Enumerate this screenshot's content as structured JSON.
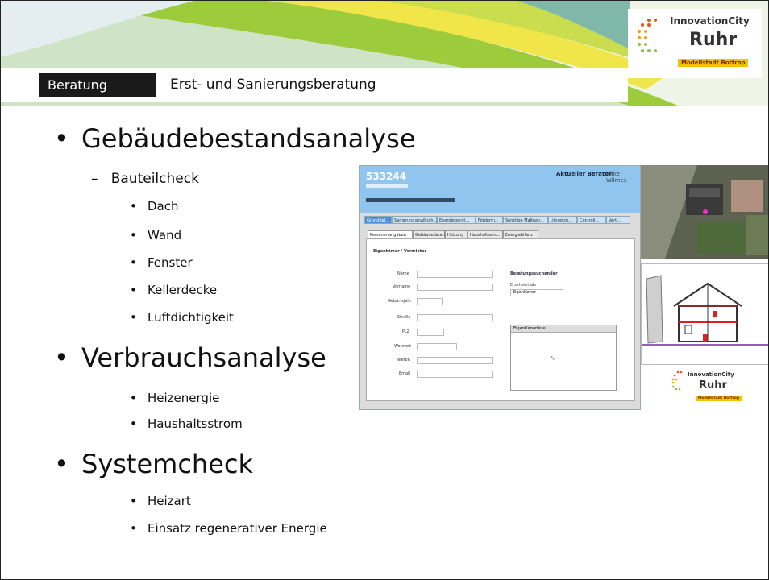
{
  "header": {
    "tab_label": "Beratung",
    "title": "Erst- und Sanierungsberatung",
    "logo": {
      "line1": "InnovationCity",
      "line2": "Ruhr",
      "badge": "Modellstadt Bottrop"
    }
  },
  "sections": [
    {
      "title": "Gebäudebestandsanalyse"
    },
    {
      "title": "Verbrauchsanalyse"
    },
    {
      "title": "Systemcheck"
    }
  ],
  "bauteil": {
    "title": "Bauteilcheck",
    "items": [
      "Dach",
      "Wand",
      "Fenster",
      "Kellerdecke",
      "Luftdichtigkeit"
    ]
  },
  "verbrauch_items": [
    "Heizenergie",
    "Haushaltsstrom"
  ],
  "system_items": [
    "Heizart",
    "Einsatz regenerativer Energie"
  ],
  "screenshot": {
    "id": "533244",
    "advisor_label": "Aktueller Berater:",
    "advisor_value": "Akke Wilmes",
    "nav_tabs": [
      "Grunddat...",
      "Sanierungsmaßnah...",
      "Energieberat...",
      "Förderm...",
      "Sonstige Maßnah...",
      "Umsetzu...",
      "Controll...",
      "Vert..."
    ],
    "sub_tabs": [
      "Personenangaben",
      "Gebäudedaten",
      "Heizung",
      "Haushaltsstro...",
      "Energiebilanz"
    ],
    "section_title": "Eigentümer / Vermieter",
    "fields": [
      "Name",
      "Vorname",
      "Geburtsjahr",
      "Straße",
      "PLZ",
      "Wohnort",
      "Telefon",
      "Email"
    ],
    "right_title": "Beratungssuchender",
    "right_sub": "Erscheint als",
    "select_value": "Eigentümer",
    "list_title": "Eigentümerliste"
  },
  "colors": {
    "header_blue": "#8fc5ee",
    "tab_blue": "#4a90d9",
    "swoosh_green": "#9ccc3c",
    "swoosh_yellow": "#f0e64a"
  }
}
